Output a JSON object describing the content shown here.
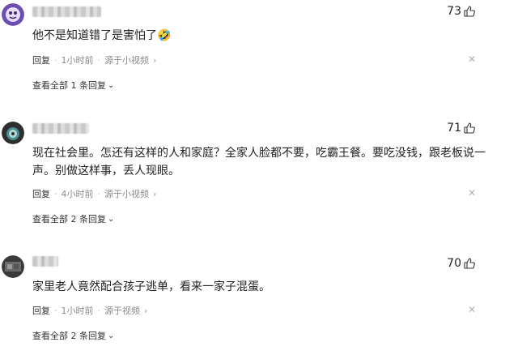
{
  "comments": [
    {
      "text": "他不是知道错了是害怕了🤣",
      "likes": "73",
      "reply_label": "回复",
      "time": "1小时前",
      "source": "源于小视频",
      "view_replies": "查看全部 1 条回复"
    },
    {
      "text": "现在社会里。怎还有这样的人和家庭？全家人脸都不要，吃霸王餐。要吃没钱，跟老板说一声。别做这样事，丢人现眼。",
      "likes": "71",
      "reply_label": "回复",
      "time": "4小时前",
      "source": "源于小视频",
      "view_replies": "查看全部 2 条回复"
    },
    {
      "text": "家里老人竟然配合孩子逃单，看来一家子混蛋。",
      "likes": "70",
      "reply_label": "回复",
      "time": "1小时前",
      "source": "源于视频",
      "view_replies": "查看全部 2 条回复"
    }
  ],
  "icons": {
    "like": "thumbs-up-icon",
    "close": "close-icon",
    "source_chevron": "chevron-right-icon",
    "expand": "chevron-down-icon"
  },
  "colors": {
    "text": "#222222",
    "meta": "#8a8a8a",
    "background": "#ffffff"
  }
}
